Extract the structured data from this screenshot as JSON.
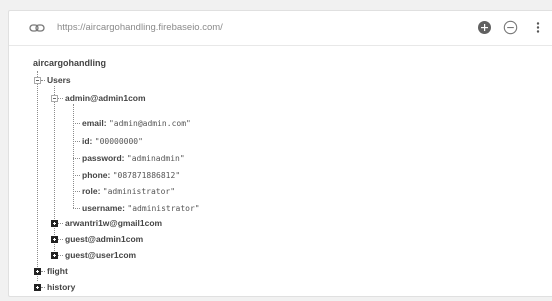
{
  "url_bar": {
    "url": "https://aircargohandling.firebaseio.com/",
    "link_icon": "link-icon",
    "add_icon": "plus-circle-icon",
    "remove_icon": "minus-circle-icon",
    "more_icon": "more-vert-icon"
  },
  "tree": {
    "root": "aircargohandling",
    "users": {
      "label": "Users",
      "admin": {
        "label": "admin@admin1com",
        "fields": [
          {
            "key": "email:",
            "value": "\"admin@admin.com\""
          },
          {
            "key": "id:",
            "value": "\"00000000\""
          },
          {
            "key": "password:",
            "value": "\"adminadmin\""
          },
          {
            "key": "phone:",
            "value": "\"087871886812\""
          },
          {
            "key": "role:",
            "value": "\"administrator\""
          },
          {
            "key": "username:",
            "value": "\"administrator\""
          }
        ]
      },
      "others": [
        "arwantri1w@gmail1com",
        "guest@admin1com",
        "guest@user1com"
      ]
    },
    "top_collapsed": [
      "flight",
      "history"
    ]
  }
}
